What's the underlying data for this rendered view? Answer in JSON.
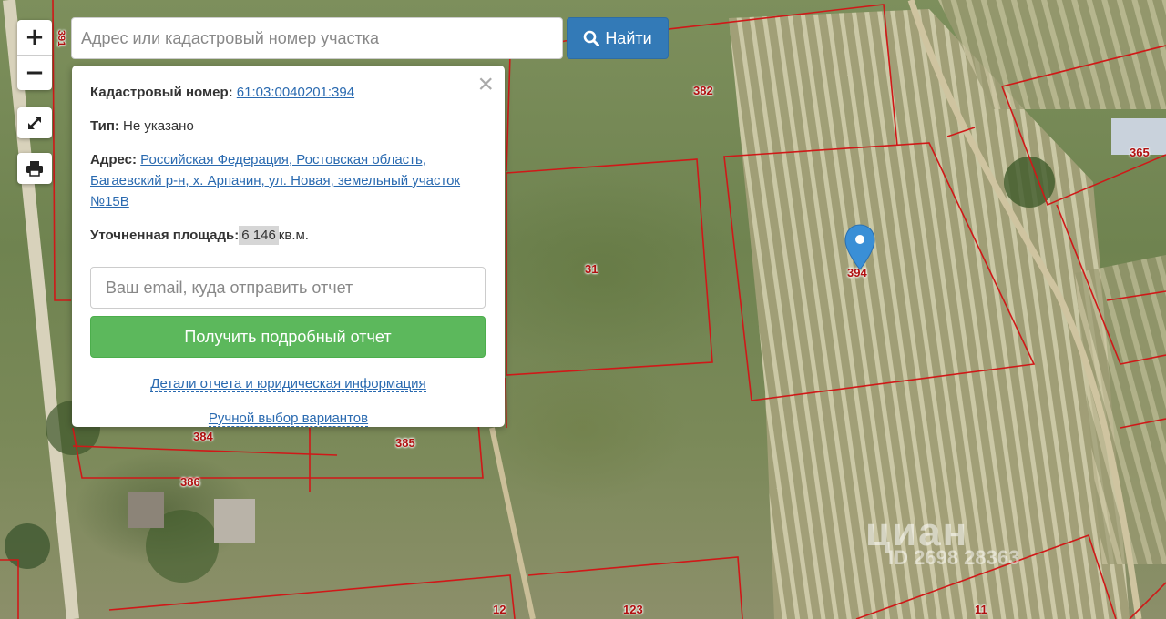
{
  "search": {
    "placeholder": "Адрес или кадастровый номер участка",
    "button_label": "Найти"
  },
  "controls": {
    "zoom_in": "+",
    "zoom_out": "−"
  },
  "popup": {
    "close": "×",
    "cadastral_label": "Кадастровый номер:",
    "cadastral_value": "61:03:0040201:394",
    "type_label": "Тип:",
    "type_value": "Не указано",
    "address_label": "Адрес:",
    "address_value": "Российская Федерация, Ростовская область, Багаевский р-н, х. Арпачин, ул. Новая, земельный участок №15В",
    "area_label": "Уточненная площадь:",
    "area_value": "6 146",
    "area_unit": "кв.м.",
    "email_placeholder": "Ваш email, куда отправить отчет",
    "report_button": "Получить подробный отчет",
    "details_link": "Детали отчета и юридическая информация",
    "manual_link": "Ручной выбор вариантов"
  },
  "map": {
    "plot_labels": [
      "382",
      "365",
      "31",
      "394",
      "384",
      "385",
      "386",
      "123",
      "11",
      "12",
      "391"
    ],
    "marker_color": "#3a8fd6",
    "boundary_color": "#d01818"
  },
  "watermark": {
    "brand": "циан",
    "id": "ID 2698 28363"
  }
}
